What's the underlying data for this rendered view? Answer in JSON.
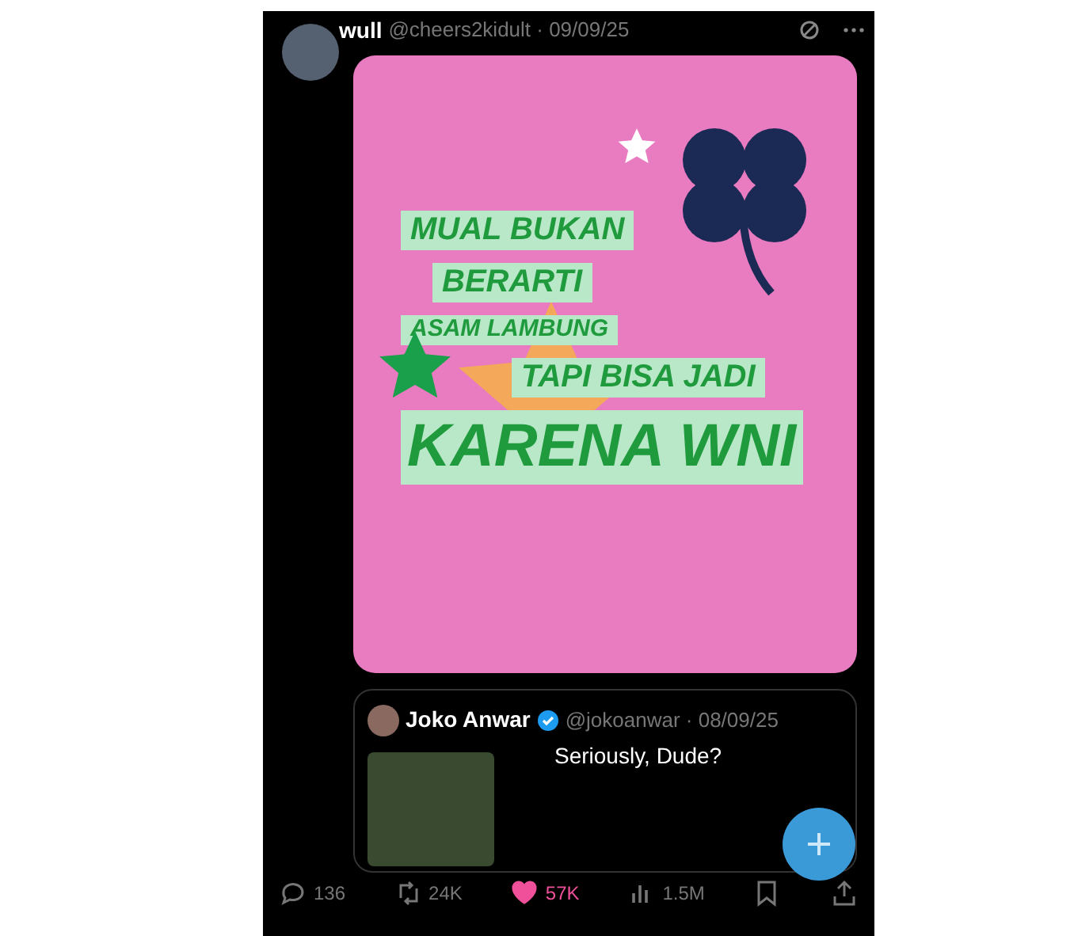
{
  "post": {
    "author": "wull",
    "handle": "@cheers2kidult · 09/09/25",
    "image_lines": [
      {
        "text": "MUAL BUKAN",
        "kind": "small"
      },
      {
        "text": "BERARTI",
        "kind": "small"
      },
      {
        "text": "ASAM LAMBUNG",
        "kind": "tiny"
      },
      {
        "text": "TAPI BISA JADI",
        "kind": "small"
      },
      {
        "text": "KARENA WNI",
        "kind": "large"
      }
    ],
    "quote": {
      "author": "Joko Anwar",
      "verified": true,
      "handle": "@jokoanwar · 08/09/25",
      "text": "Seriously, Dude?"
    },
    "actions": [
      {
        "kind": "reply",
        "count": "136",
        "active": false
      },
      {
        "kind": "repost",
        "count": "24K",
        "active": false
      },
      {
        "kind": "like",
        "count": "57K",
        "active": true
      },
      {
        "kind": "views",
        "count": "1.5M",
        "active": false
      },
      {
        "kind": "bookmark",
        "active": false
      },
      {
        "kind": "share",
        "active": false
      }
    ]
  }
}
